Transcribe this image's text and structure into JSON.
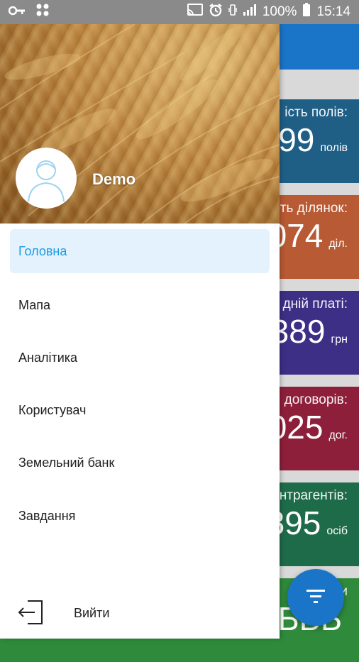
{
  "statusbar": {
    "battery": "100%",
    "time": "15:14",
    "icons": [
      "key-icon",
      "apps-icon",
      "cast-icon",
      "alarm-icon",
      "vibrate-icon",
      "signal-icon",
      "battery-icon"
    ]
  },
  "drawer": {
    "username": "Demo",
    "menu": [
      {
        "label": "Головна",
        "active": true
      },
      {
        "label": "Мапа",
        "active": false
      },
      {
        "label": "Аналітика",
        "active": false
      },
      {
        "label": "Користувач",
        "active": false
      },
      {
        "label": "Земельний банк",
        "active": false
      },
      {
        "label": "Завдання",
        "active": false
      }
    ],
    "logout_label": "Вийти"
  },
  "cards": [
    {
      "label": "ість полів:",
      "value": "99",
      "unit": "полів",
      "color": "#1f5f86"
    },
    {
      "label": "ть ділянок:",
      "value": "074",
      "unit": "діл.",
      "color": "#b85a34"
    },
    {
      "label": "дній платі:",
      "value": "389",
      "unit": "грн",
      "color": "#3d2e86"
    },
    {
      "label": "договорів:",
      "value": "025",
      "unit": "дог.",
      "color": "#8e1f3a"
    },
    {
      "label": "нтрагентів:",
      "value": "895",
      "unit": "осіб",
      "color": "#1e6b4a"
    },
    {
      "label": "ти",
      "value": "ББЬ",
      "unit": "",
      "color": "#2f8a3c"
    }
  ],
  "colors": {
    "appbar": "#1a75c9",
    "accent": "#1e9be0",
    "active_bg": "#e3f2fd"
  }
}
